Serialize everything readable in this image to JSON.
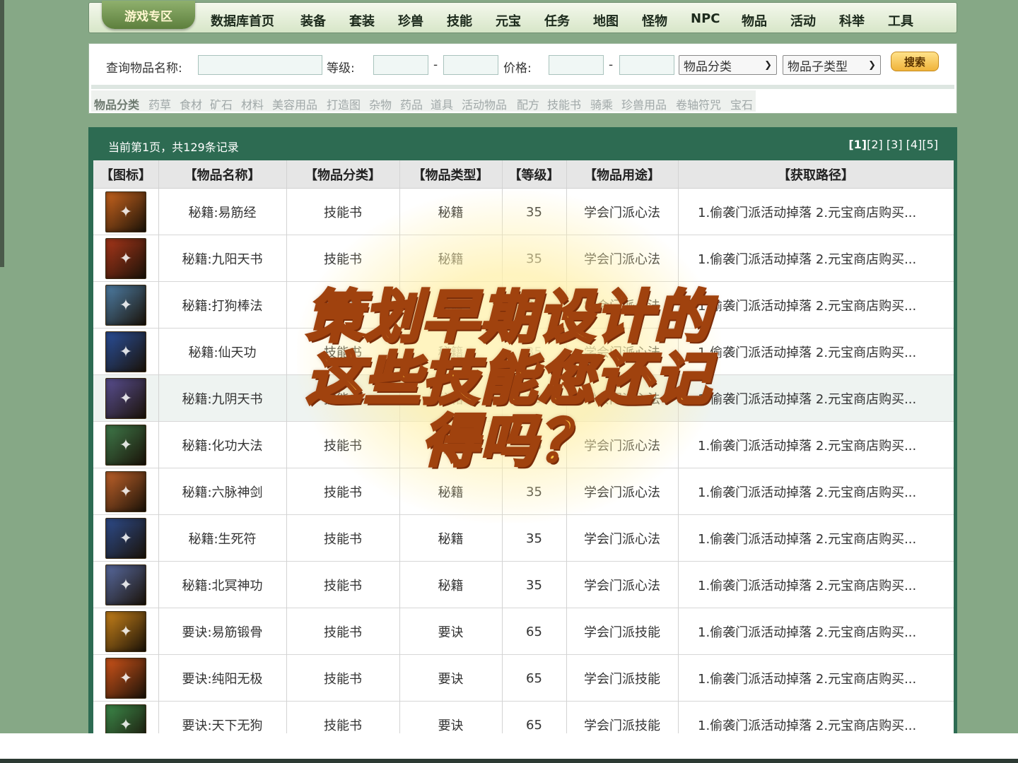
{
  "nav": {
    "zone_label": "游戏专区",
    "items": [
      "数据库首页",
      "装备",
      "套装",
      "珍兽",
      "技能",
      "元宝",
      "任务",
      "地图",
      "怪物",
      "NPC",
      "物品",
      "活动",
      "科举",
      "工具"
    ]
  },
  "search": {
    "name_label": "查询物品名称:",
    "level_label": "等级:",
    "range_dash": "-",
    "price_label": "价格:",
    "category_select": "物品分类",
    "subtype_select": "物品子类型",
    "button": "搜索"
  },
  "categories": [
    "物品分类",
    "药草",
    "食材",
    "矿石",
    "材料",
    "美容用品",
    "打造图",
    "杂物",
    "药品",
    "道具",
    "活动物品",
    "配方",
    "技能书",
    "骑乘",
    "珍兽用品",
    "卷轴符咒",
    "宝石"
  ],
  "results": {
    "summary": "当前第1页，共129条记录",
    "pages": [
      "[1]",
      "[2]",
      "[3]",
      "[4]",
      "[5]"
    ]
  },
  "table": {
    "headers": [
      "【图标】",
      "【物品名称】",
      "【物品分类】",
      "【物品类型】",
      "【等级】",
      "【物品用途】",
      "【获取路径】"
    ],
    "rows": [
      {
        "name": "秘籍:易筋经",
        "category": "技能书",
        "type": "秘籍",
        "level": "35",
        "use": "学会门派心法",
        "path": "1.偷袭门派活动掉落 2.元宝商店购买...",
        "icon": "book-fire-icon",
        "color": "#c9641e"
      },
      {
        "name": "秘籍:九阳天书",
        "category": "技能书",
        "type": "秘籍",
        "level": "35",
        "use": "学会门派心法",
        "path": "1.偷袭门派活动掉落 2.元宝商店购买...",
        "icon": "gift-box-icon",
        "color": "#a8361a"
      },
      {
        "name": "秘籍:打狗棒法",
        "category": "技能书",
        "type": "秘籍",
        "level": "35",
        "use": "学会门派心法",
        "path": "1.偷袭门派活动掉落 2.元宝商店购买...",
        "icon": "scroll-icon",
        "color": "#4e7ea6"
      },
      {
        "name": "秘籍:仙天功",
        "category": "技能书",
        "type": "秘籍",
        "level": "35",
        "use": "学会门派心法",
        "path": "1.偷袭门派活动掉落 2.元宝商店购买...",
        "icon": "blue-book-icon",
        "color": "#2a4f9a"
      },
      {
        "name": "秘籍:九阴天书",
        "category": "技能书",
        "type": "秘籍",
        "level": "35",
        "use": "学会门派心法",
        "path": "1.偷袭门派活动掉落 2.元宝商店购买...",
        "icon": "purple-book-icon",
        "color": "#5a4f92"
      },
      {
        "name": "秘籍:化功大法",
        "category": "技能书",
        "type": "秘籍",
        "level": "35",
        "use": "学会门派心法",
        "path": "1.偷袭门派活动掉落 2.元宝商店购买...",
        "icon": "green-book-icon",
        "color": "#3f7a4a"
      },
      {
        "name": "秘籍:六脉神剑",
        "category": "技能书",
        "type": "秘籍",
        "level": "35",
        "use": "学会门派心法",
        "path": "1.偷袭门派活动掉落 2.元宝商店购买...",
        "icon": "book-stack-icon",
        "color": "#c0622a"
      },
      {
        "name": "秘籍:生死符",
        "category": "技能书",
        "type": "秘籍",
        "level": "35",
        "use": "学会门派心法",
        "path": "1.偷袭门派活动掉落 2.元宝商店购买...",
        "icon": "rune-scroll-icon",
        "color": "#2e4c8c"
      },
      {
        "name": "秘籍:北冥神功",
        "category": "技能书",
        "type": "秘籍",
        "level": "35",
        "use": "学会门派心法",
        "path": "1.偷袭门派活动掉落 2.元宝商店购买...",
        "icon": "map-scroll-icon",
        "color": "#586aa0"
      },
      {
        "name": "要诀:易筋锻骨",
        "category": "技能书",
        "type": "要诀",
        "level": "65",
        "use": "学会门派技能",
        "path": "1.偷袭门派活动掉落 2.元宝商店购买...",
        "icon": "kick-figure-icon",
        "color": "#c8821a"
      },
      {
        "name": "要诀:纯阳无极",
        "category": "技能书",
        "type": "要诀",
        "level": "65",
        "use": "学会门派技能",
        "path": "1.偷袭门派活动掉落 2.元宝商店购买...",
        "icon": "figure-burst-icon",
        "color": "#d0541a"
      },
      {
        "name": "要诀:天下无狗",
        "category": "技能书",
        "type": "要诀",
        "level": "65",
        "use": "学会门派技能",
        "path": "1.偷袭门派活动掉落 2.元宝商店购买...",
        "icon": "green-lightning-icon",
        "color": "#3c8a4a"
      }
    ]
  },
  "overlay": {
    "line1": "策划早期设计的",
    "line2": "这些技能您还记",
    "line3": "得吗？"
  }
}
